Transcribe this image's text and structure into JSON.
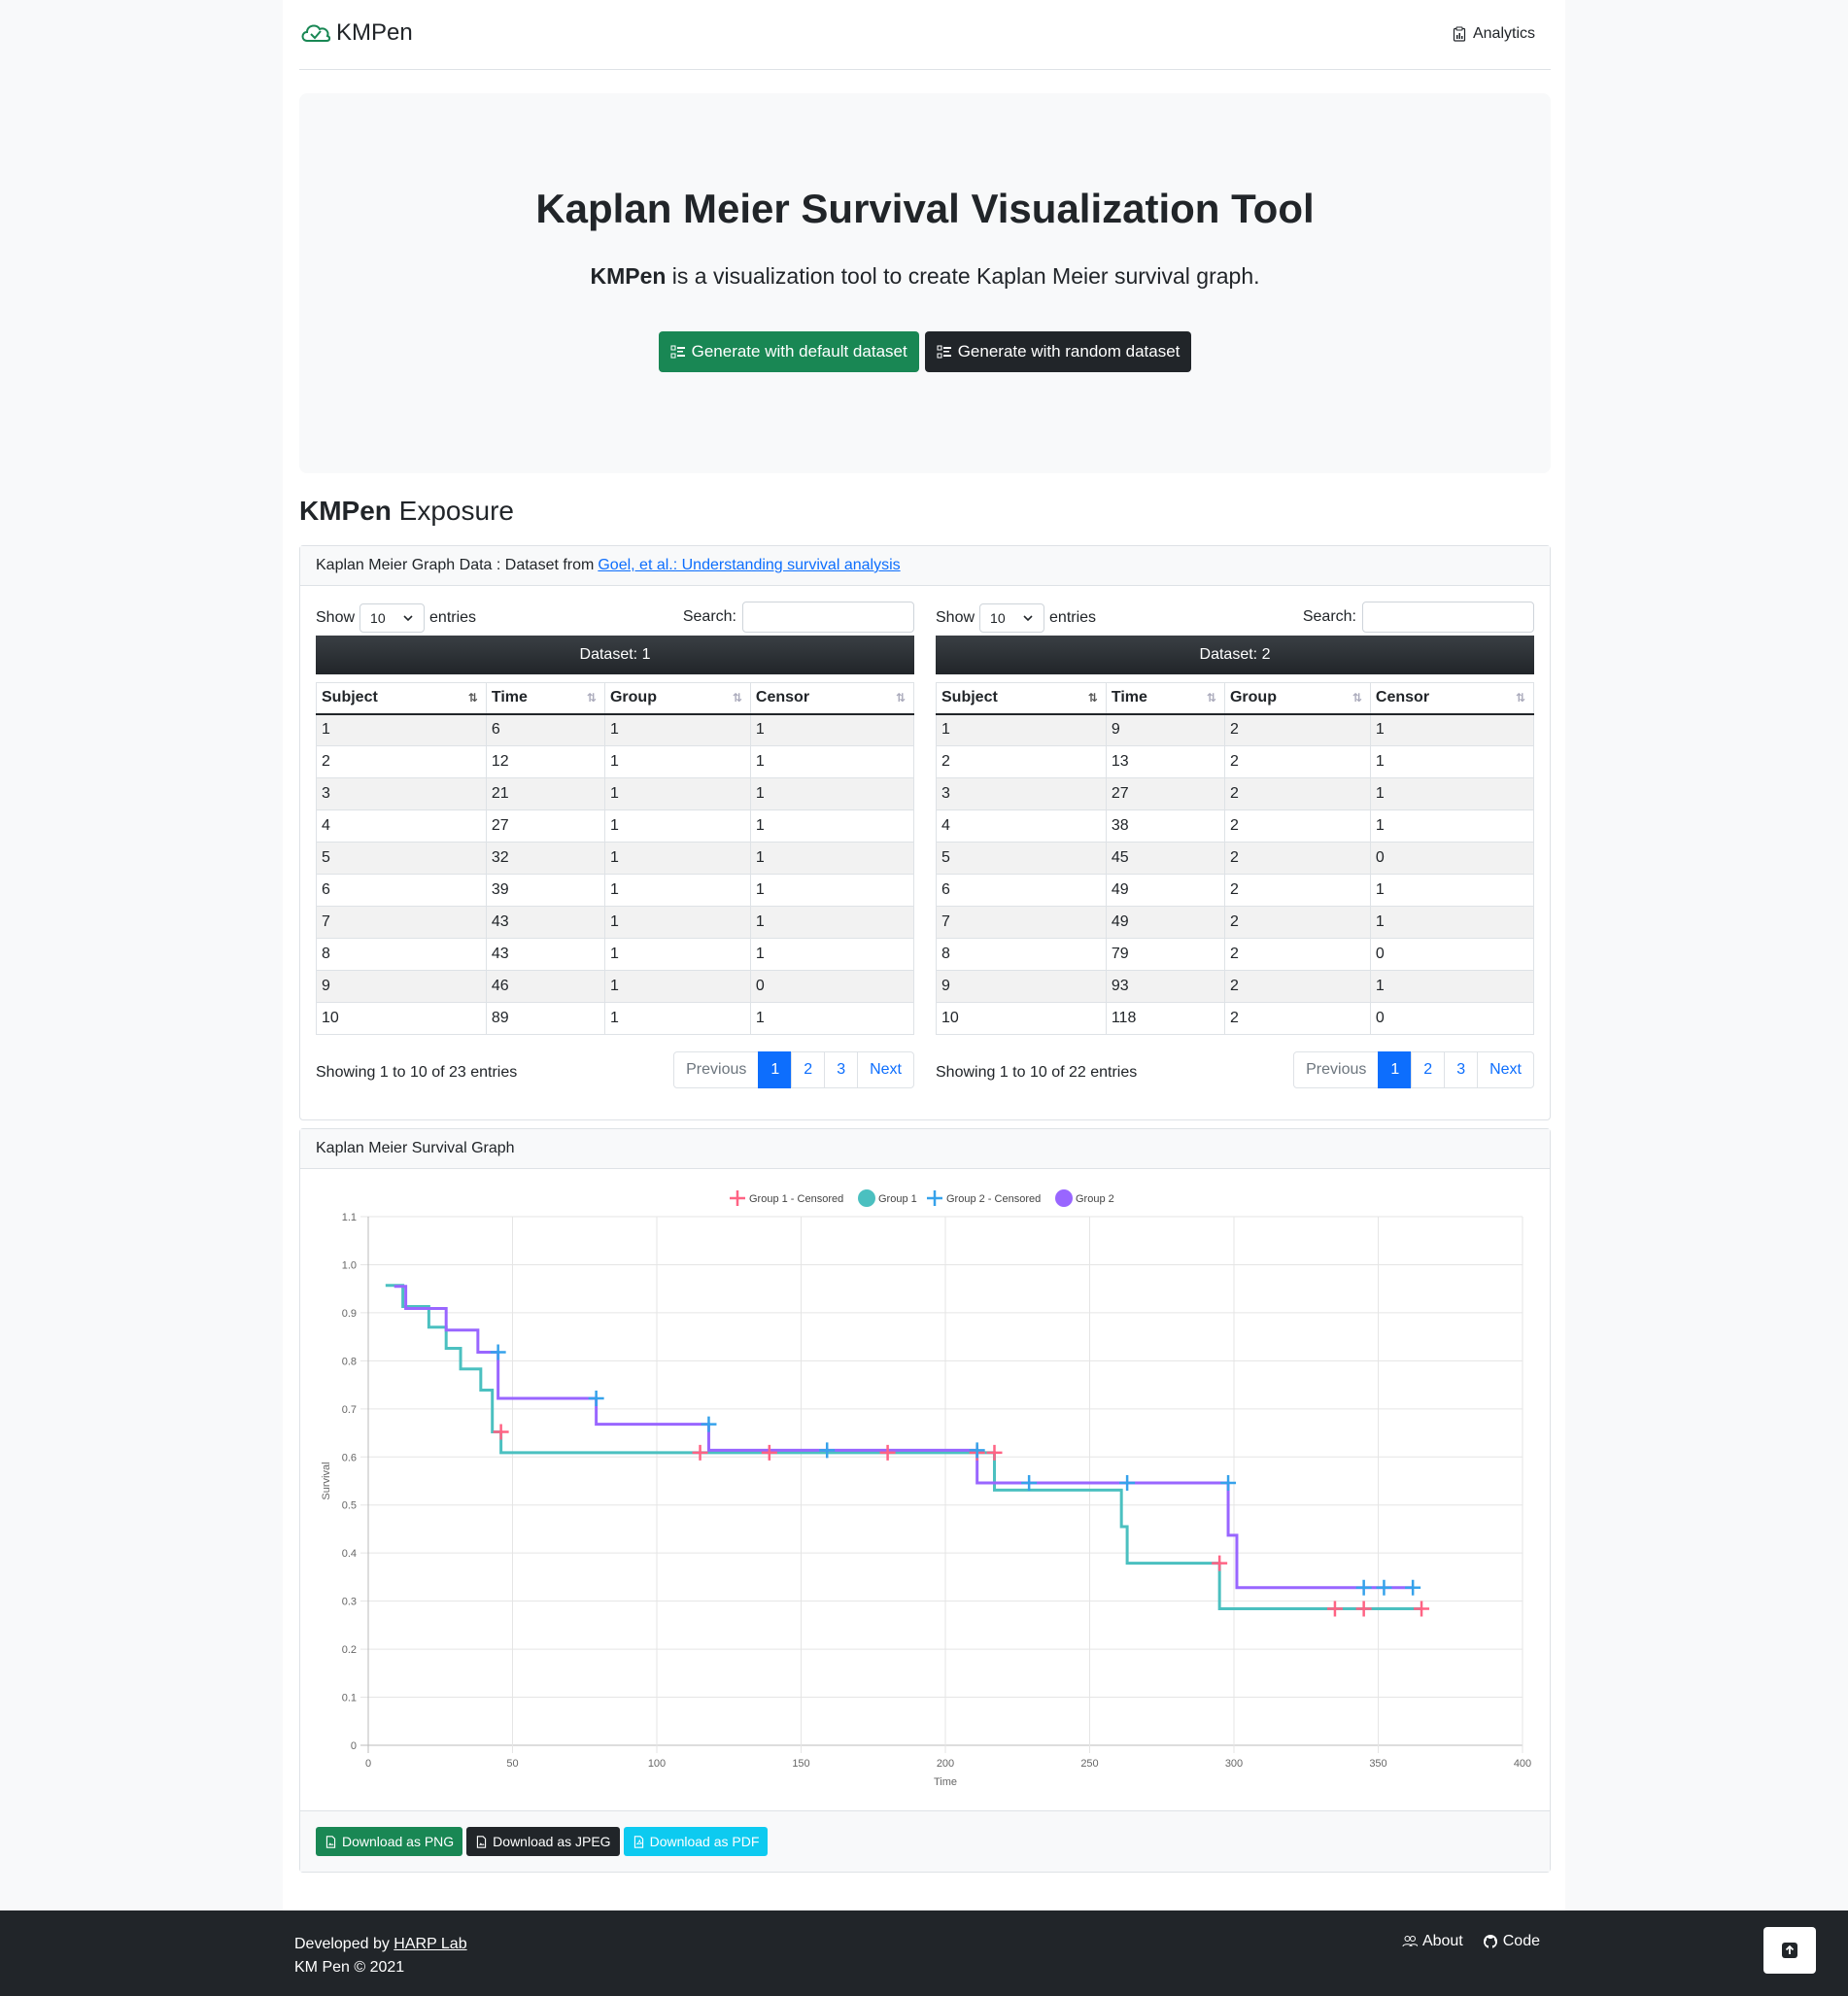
{
  "nav": {
    "brand": "KMPen",
    "analytics": "Analytics"
  },
  "hero": {
    "title": "Kaplan Meier Survival Visualization Tool",
    "lead_bold": "KMPen",
    "lead_rest": " is a visualization tool to create Kaplan Meier survival graph.",
    "btn_default": "Generate with default dataset",
    "btn_random": "Generate with random dataset"
  },
  "section": {
    "bold": "KMPen",
    "rest": " Exposure"
  },
  "data_card": {
    "header_text": "Kaplan Meier Graph Data : Dataset from",
    "header_link": "Goel, et al.: Understanding survival analysis"
  },
  "tables": [
    {
      "show_label": "Show",
      "entries_value": "10",
      "entries_label": "entries",
      "search_label": "Search:",
      "caption": "Dataset: 1",
      "columns": [
        "Subject",
        "Time",
        "Group",
        "Censor"
      ],
      "rows": [
        [
          "1",
          "6",
          "1",
          "1"
        ],
        [
          "2",
          "12",
          "1",
          "1"
        ],
        [
          "3",
          "21",
          "1",
          "1"
        ],
        [
          "4",
          "27",
          "1",
          "1"
        ],
        [
          "5",
          "32",
          "1",
          "1"
        ],
        [
          "6",
          "39",
          "1",
          "1"
        ],
        [
          "7",
          "43",
          "1",
          "1"
        ],
        [
          "8",
          "43",
          "1",
          "1"
        ],
        [
          "9",
          "46",
          "1",
          "0"
        ],
        [
          "10",
          "89",
          "1",
          "1"
        ]
      ],
      "info": "Showing 1 to 10 of 23 entries",
      "pager": [
        "Previous",
        "1",
        "2",
        "3",
        "Next"
      ]
    },
    {
      "show_label": "Show",
      "entries_value": "10",
      "entries_label": "entries",
      "search_label": "Search:",
      "caption": "Dataset: 2",
      "columns": [
        "Subject",
        "Time",
        "Group",
        "Censor"
      ],
      "rows": [
        [
          "1",
          "9",
          "2",
          "1"
        ],
        [
          "2",
          "13",
          "2",
          "1"
        ],
        [
          "3",
          "27",
          "2",
          "1"
        ],
        [
          "4",
          "38",
          "2",
          "1"
        ],
        [
          "5",
          "45",
          "2",
          "0"
        ],
        [
          "6",
          "49",
          "2",
          "1"
        ],
        [
          "7",
          "49",
          "2",
          "1"
        ],
        [
          "8",
          "79",
          "2",
          "0"
        ],
        [
          "9",
          "93",
          "2",
          "1"
        ],
        [
          "10",
          "118",
          "2",
          "0"
        ]
      ],
      "info": "Showing 1 to 10 of 22 entries",
      "pager": [
        "Previous",
        "1",
        "2",
        "3",
        "Next"
      ]
    }
  ],
  "graph_card": {
    "header": "Kaplan Meier Survival Graph"
  },
  "downloads": {
    "png": "Download as PNG",
    "jpeg": "Download as JPEG",
    "pdf": "Download as PDF"
  },
  "footer": {
    "developed_by": "Developed by",
    "lab": "HARP Lab",
    "copyright": "KM Pen © 2021",
    "about": "About",
    "code": "Code"
  },
  "colors": {
    "group1": "#4bc0c0",
    "group2": "#9966ff",
    "group1_censored": "#ff6384",
    "group2_censored": "#36a2eb"
  },
  "chart_data": {
    "type": "line",
    "xlabel": "Time",
    "ylabel": "Survival",
    "xlim": [
      0,
      400
    ],
    "ylim": [
      0,
      1.1
    ],
    "xticks": [
      "0",
      "50",
      "100",
      "150",
      "200",
      "250",
      "300",
      "350",
      "400"
    ],
    "yticks": [
      "0",
      "0.1",
      "0.2",
      "0.3",
      "0.4",
      "0.5",
      "0.6",
      "0.7",
      "0.8",
      "0.9",
      "1.0",
      "1.1"
    ],
    "legend": "top",
    "grid": true,
    "series": [
      {
        "name": "Group 1",
        "kind": "step",
        "color": "#4bc0c0",
        "points": [
          [
            6,
            0.957
          ],
          [
            12,
            0.913
          ],
          [
            21,
            0.87
          ],
          [
            27,
            0.826
          ],
          [
            32,
            0.783
          ],
          [
            39,
            0.739
          ],
          [
            43,
            0.652
          ],
          [
            46,
            0.652
          ],
          [
            46,
            0.609
          ],
          [
            89,
            0.609
          ],
          [
            115,
            0.609
          ],
          [
            139,
            0.609
          ],
          [
            180,
            0.609
          ],
          [
            217,
            0.609
          ],
          [
            217,
            0.531
          ],
          [
            261,
            0.531
          ],
          [
            261,
            0.455
          ],
          [
            263,
            0.455
          ],
          [
            263,
            0.379
          ],
          [
            295,
            0.379
          ],
          [
            295,
            0.284
          ],
          [
            365,
            0.284
          ]
        ]
      },
      {
        "name": "Group 2",
        "kind": "step",
        "color": "#9966ff",
        "points": [
          [
            9,
            0.955
          ],
          [
            13,
            0.909
          ],
          [
            27,
            0.864
          ],
          [
            38,
            0.818
          ],
          [
            45,
            0.818
          ],
          [
            45,
            0.722
          ],
          [
            79,
            0.722
          ],
          [
            79,
            0.668
          ],
          [
            118,
            0.668
          ],
          [
            118,
            0.614
          ],
          [
            211,
            0.614
          ],
          [
            211,
            0.546
          ],
          [
            298,
            0.546
          ],
          [
            298,
            0.437
          ],
          [
            301,
            0.437
          ],
          [
            301,
            0.328
          ],
          [
            362,
            0.328
          ]
        ]
      },
      {
        "name": "Group 1 - Censored",
        "kind": "censor",
        "color": "#ff6384",
        "points": [
          [
            46,
            0.652
          ],
          [
            115,
            0.609
          ],
          [
            139,
            0.609
          ],
          [
            180,
            0.609
          ],
          [
            211,
            0.609
          ],
          [
            217,
            0.609
          ],
          [
            295,
            0.379
          ],
          [
            335,
            0.284
          ],
          [
            345,
            0.284
          ],
          [
            365,
            0.284
          ]
        ]
      },
      {
        "name": "Group 2 - Censored",
        "kind": "censor",
        "color": "#36a2eb",
        "points": [
          [
            45,
            0.818
          ],
          [
            79,
            0.722
          ],
          [
            118,
            0.668
          ],
          [
            159,
            0.614
          ],
          [
            211,
            0.614
          ],
          [
            229,
            0.546
          ],
          [
            263,
            0.546
          ],
          [
            298,
            0.546
          ],
          [
            345,
            0.328
          ],
          [
            352,
            0.328
          ],
          [
            362,
            0.328
          ]
        ]
      }
    ],
    "legend_order": [
      "Group 1 - Censored",
      "Group 1",
      "Group 2 - Censored",
      "Group 2"
    ]
  }
}
